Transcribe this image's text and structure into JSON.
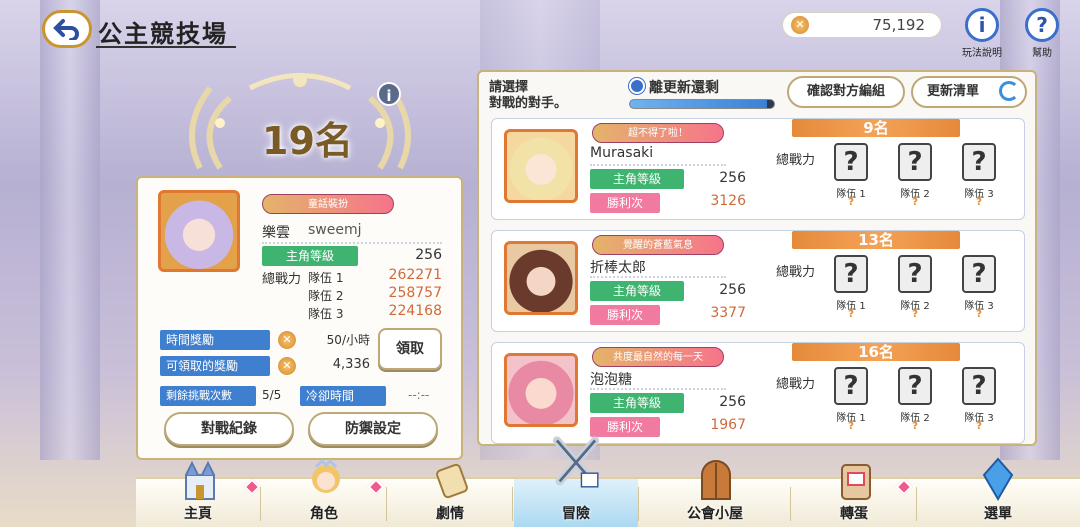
{
  "header": {
    "title": "公主競技場",
    "currency_icon": "coin-icon",
    "currency_amount": "75,192",
    "rules_label": "玩法說明",
    "help_label": "幫助"
  },
  "rank": {
    "text": "19名"
  },
  "player": {
    "badge": "童話裝扮",
    "name": "樂雲",
    "id": "sweemj",
    "level_label": "主角等級",
    "level": "256",
    "power_label": "總戰力",
    "teams": [
      {
        "label": "隊伍 1",
        "value": "262271"
      },
      {
        "label": "隊伍 2",
        "value": "258757"
      },
      {
        "label": "隊伍 3",
        "value": "224168"
      }
    ]
  },
  "rewards": {
    "time_label": "時間獎勵",
    "time_value": "50/小時",
    "claimable_label": "可領取的獎勵",
    "claimable_value": "4,336",
    "claim_button": "領取",
    "attempts_label": "剩餘挑戰次數",
    "attempts_value": "5/5",
    "cooldown_label": "冷卻時間",
    "cooldown_value": "--:--"
  },
  "buttons": {
    "record": "對戰紀錄",
    "defense": "防禦設定"
  },
  "opponents_header": {
    "prompt_line1": "請選擇",
    "prompt_line2": "對戰的對手。",
    "refresh_label": "離更新還剩",
    "refresh_progress": 0.95,
    "confirm_button": "確認對方編組",
    "refresh_button": "更新清單"
  },
  "opponents": [
    {
      "badge": "超不得了啦！",
      "name": "Murasaki",
      "level_label": "主角等級",
      "level": "256",
      "wins_label": "勝利次",
      "wins": "3126",
      "rank": "9名",
      "power_label": "總戰力",
      "teams": [
        {
          "label": "隊伍 1",
          "mark": "?"
        },
        {
          "label": "隊伍 2",
          "mark": "?"
        },
        {
          "label": "隊伍 3",
          "mark": "?"
        }
      ]
    },
    {
      "badge": "覺醒的蒼藍氣息",
      "name": "折棒太郎",
      "level_label": "主角等級",
      "level": "256",
      "wins_label": "勝利次",
      "wins": "3377",
      "rank": "13名",
      "power_label": "總戰力",
      "teams": [
        {
          "label": "隊伍 1",
          "mark": "?"
        },
        {
          "label": "隊伍 2",
          "mark": "?"
        },
        {
          "label": "隊伍 3",
          "mark": "?"
        }
      ]
    },
    {
      "badge": "共度最自然的每一天",
      "name": "泡泡糖",
      "level_label": "主角等級",
      "level": "256",
      "wins_label": "勝利次",
      "wins": "1967",
      "rank": "16名",
      "power_label": "總戰力",
      "teams": [
        {
          "label": "隊伍 1",
          "mark": "?"
        },
        {
          "label": "隊伍 2",
          "mark": "?"
        },
        {
          "label": "隊伍 3",
          "mark": "?"
        }
      ]
    }
  ],
  "nav": [
    {
      "label": "主頁"
    },
    {
      "label": "角色"
    },
    {
      "label": "劇情"
    },
    {
      "label": "冒險"
    },
    {
      "label": "公會小屋"
    },
    {
      "label": "轉蛋"
    },
    {
      "label": "選單"
    }
  ],
  "colors": {
    "accent": "#3a6fcb",
    "gold": "#c9962e",
    "power": "#d06a3a",
    "level_green": "#3fb470",
    "wins_pink": "#f07aa0"
  }
}
